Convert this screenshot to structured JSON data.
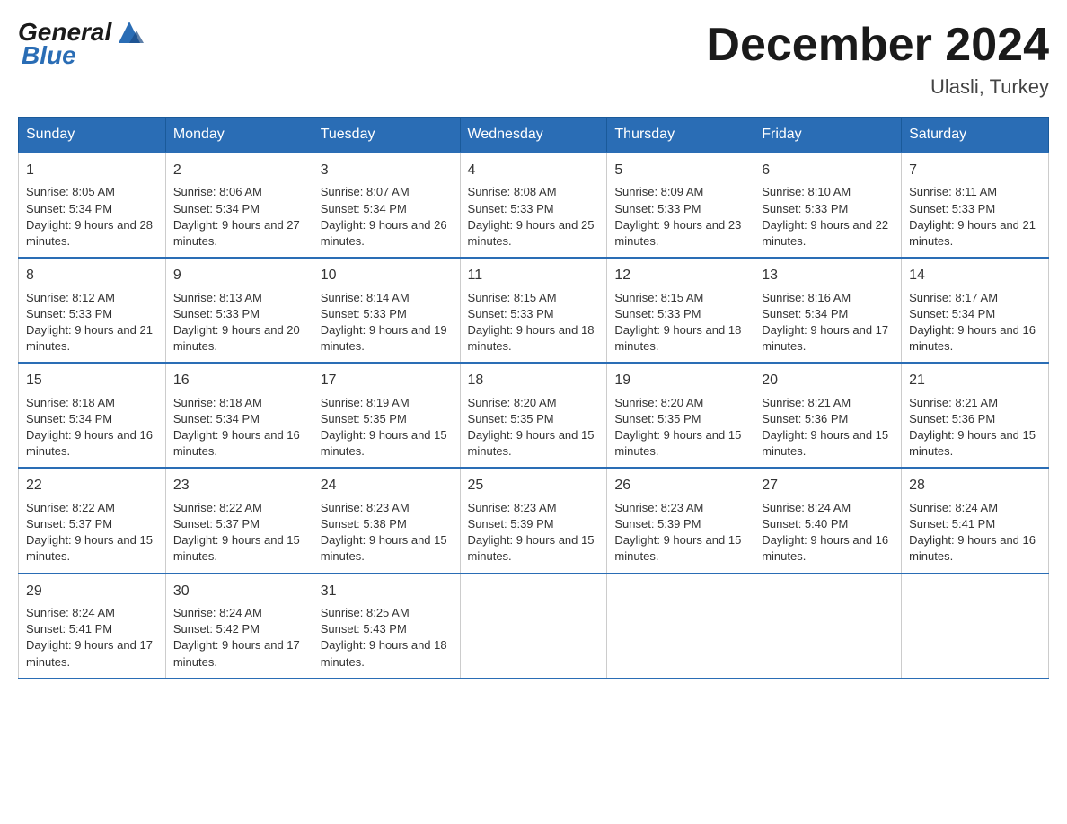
{
  "logo": {
    "text_general": "General",
    "text_blue": "Blue"
  },
  "title": "December 2024",
  "subtitle": "Ulasli, Turkey",
  "days_of_week": [
    "Sunday",
    "Monday",
    "Tuesday",
    "Wednesday",
    "Thursday",
    "Friday",
    "Saturday"
  ],
  "weeks": [
    [
      {
        "day": "1",
        "sunrise": "8:05 AM",
        "sunset": "5:34 PM",
        "daylight": "9 hours and 28 minutes."
      },
      {
        "day": "2",
        "sunrise": "8:06 AM",
        "sunset": "5:34 PM",
        "daylight": "9 hours and 27 minutes."
      },
      {
        "day": "3",
        "sunrise": "8:07 AM",
        "sunset": "5:34 PM",
        "daylight": "9 hours and 26 minutes."
      },
      {
        "day": "4",
        "sunrise": "8:08 AM",
        "sunset": "5:33 PM",
        "daylight": "9 hours and 25 minutes."
      },
      {
        "day": "5",
        "sunrise": "8:09 AM",
        "sunset": "5:33 PM",
        "daylight": "9 hours and 23 minutes."
      },
      {
        "day": "6",
        "sunrise": "8:10 AM",
        "sunset": "5:33 PM",
        "daylight": "9 hours and 22 minutes."
      },
      {
        "day": "7",
        "sunrise": "8:11 AM",
        "sunset": "5:33 PM",
        "daylight": "9 hours and 21 minutes."
      }
    ],
    [
      {
        "day": "8",
        "sunrise": "8:12 AM",
        "sunset": "5:33 PM",
        "daylight": "9 hours and 21 minutes."
      },
      {
        "day": "9",
        "sunrise": "8:13 AM",
        "sunset": "5:33 PM",
        "daylight": "9 hours and 20 minutes."
      },
      {
        "day": "10",
        "sunrise": "8:14 AM",
        "sunset": "5:33 PM",
        "daylight": "9 hours and 19 minutes."
      },
      {
        "day": "11",
        "sunrise": "8:15 AM",
        "sunset": "5:33 PM",
        "daylight": "9 hours and 18 minutes."
      },
      {
        "day": "12",
        "sunrise": "8:15 AM",
        "sunset": "5:33 PM",
        "daylight": "9 hours and 18 minutes."
      },
      {
        "day": "13",
        "sunrise": "8:16 AM",
        "sunset": "5:34 PM",
        "daylight": "9 hours and 17 minutes."
      },
      {
        "day": "14",
        "sunrise": "8:17 AM",
        "sunset": "5:34 PM",
        "daylight": "9 hours and 16 minutes."
      }
    ],
    [
      {
        "day": "15",
        "sunrise": "8:18 AM",
        "sunset": "5:34 PM",
        "daylight": "9 hours and 16 minutes."
      },
      {
        "day": "16",
        "sunrise": "8:18 AM",
        "sunset": "5:34 PM",
        "daylight": "9 hours and 16 minutes."
      },
      {
        "day": "17",
        "sunrise": "8:19 AM",
        "sunset": "5:35 PM",
        "daylight": "9 hours and 15 minutes."
      },
      {
        "day": "18",
        "sunrise": "8:20 AM",
        "sunset": "5:35 PM",
        "daylight": "9 hours and 15 minutes."
      },
      {
        "day": "19",
        "sunrise": "8:20 AM",
        "sunset": "5:35 PM",
        "daylight": "9 hours and 15 minutes."
      },
      {
        "day": "20",
        "sunrise": "8:21 AM",
        "sunset": "5:36 PM",
        "daylight": "9 hours and 15 minutes."
      },
      {
        "day": "21",
        "sunrise": "8:21 AM",
        "sunset": "5:36 PM",
        "daylight": "9 hours and 15 minutes."
      }
    ],
    [
      {
        "day": "22",
        "sunrise": "8:22 AM",
        "sunset": "5:37 PM",
        "daylight": "9 hours and 15 minutes."
      },
      {
        "day": "23",
        "sunrise": "8:22 AM",
        "sunset": "5:37 PM",
        "daylight": "9 hours and 15 minutes."
      },
      {
        "day": "24",
        "sunrise": "8:23 AM",
        "sunset": "5:38 PM",
        "daylight": "9 hours and 15 minutes."
      },
      {
        "day": "25",
        "sunrise": "8:23 AM",
        "sunset": "5:39 PM",
        "daylight": "9 hours and 15 minutes."
      },
      {
        "day": "26",
        "sunrise": "8:23 AM",
        "sunset": "5:39 PM",
        "daylight": "9 hours and 15 minutes."
      },
      {
        "day": "27",
        "sunrise": "8:24 AM",
        "sunset": "5:40 PM",
        "daylight": "9 hours and 16 minutes."
      },
      {
        "day": "28",
        "sunrise": "8:24 AM",
        "sunset": "5:41 PM",
        "daylight": "9 hours and 16 minutes."
      }
    ],
    [
      {
        "day": "29",
        "sunrise": "8:24 AM",
        "sunset": "5:41 PM",
        "daylight": "9 hours and 17 minutes."
      },
      {
        "day": "30",
        "sunrise": "8:24 AM",
        "sunset": "5:42 PM",
        "daylight": "9 hours and 17 minutes."
      },
      {
        "day": "31",
        "sunrise": "8:25 AM",
        "sunset": "5:43 PM",
        "daylight": "9 hours and 18 minutes."
      },
      null,
      null,
      null,
      null
    ]
  ]
}
